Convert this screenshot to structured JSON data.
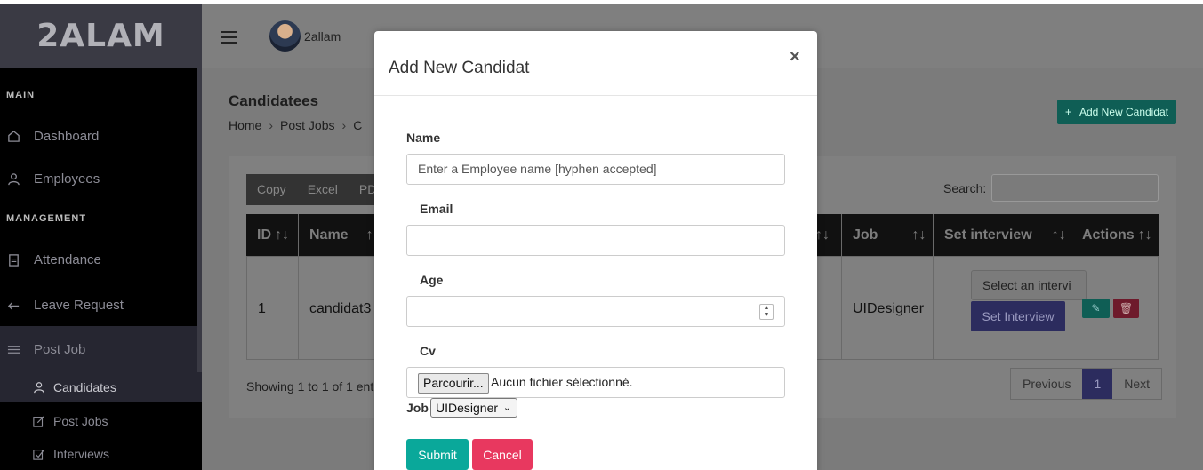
{
  "sidebar": {
    "brand": "2ALAM",
    "sections": [
      {
        "label": "MAIN"
      },
      {
        "label": "MANAGEMENT"
      }
    ],
    "items": [
      {
        "label": "Dashboard",
        "icon": "home-icon"
      },
      {
        "label": "Employees",
        "icon": "user-icon"
      },
      {
        "label": "Attendance",
        "icon": "clipboard-icon"
      },
      {
        "label": "Leave Request",
        "icon": "arrow-left-icon"
      },
      {
        "label": "Post Job",
        "icon": "menu-icon"
      }
    ],
    "subitems": [
      {
        "label": "Candidates",
        "icon": "user-icon"
      },
      {
        "label": "Post Jobs",
        "icon": "edit-icon"
      },
      {
        "label": "Interviews",
        "icon": "check-square-icon"
      }
    ]
  },
  "header": {
    "username": "2allam"
  },
  "page": {
    "title": "Candidatees",
    "breadcrumbs": [
      "Home",
      "Post Jobs",
      "C"
    ],
    "add_button": "Add New Candidat",
    "export_buttons": [
      "Copy",
      "Excel",
      "PD"
    ],
    "search_label": "Search:",
    "table": {
      "headers": [
        "ID",
        "Name",
        "Job",
        "Set interview",
        "Actions"
      ],
      "row": {
        "id": "1",
        "name": "candidat3",
        "job": "UIDesigner",
        "interview_select": "Select an intervi",
        "set_interview_button": "Set Interview"
      }
    },
    "showing": "Showing 1 to 1 of 1 ent",
    "pagination": {
      "previous": "Previous",
      "current": "1",
      "next": "Next"
    }
  },
  "modal": {
    "title": "Add New Candidat",
    "close": "×",
    "fields": {
      "name_label": "Name",
      "name_placeholder": "Enter a Employee name [hyphen accepted]",
      "email_label": "Email",
      "email_value": "",
      "age_label": "Age",
      "age_value": "",
      "cv_label": "Cv",
      "file_button": "Parcourir...",
      "file_status": "Aucun fichier sélectionné.",
      "job_label": "Job",
      "job_value": "UIDesigner"
    },
    "submit": "Submit",
    "cancel": "Cancel"
  },
  "colors": {
    "sidebar_bg": "#000000",
    "submit": "#0aa89a",
    "cancel": "#e8385f",
    "primary": "#3f3fa8",
    "teal": "#1aa193"
  }
}
